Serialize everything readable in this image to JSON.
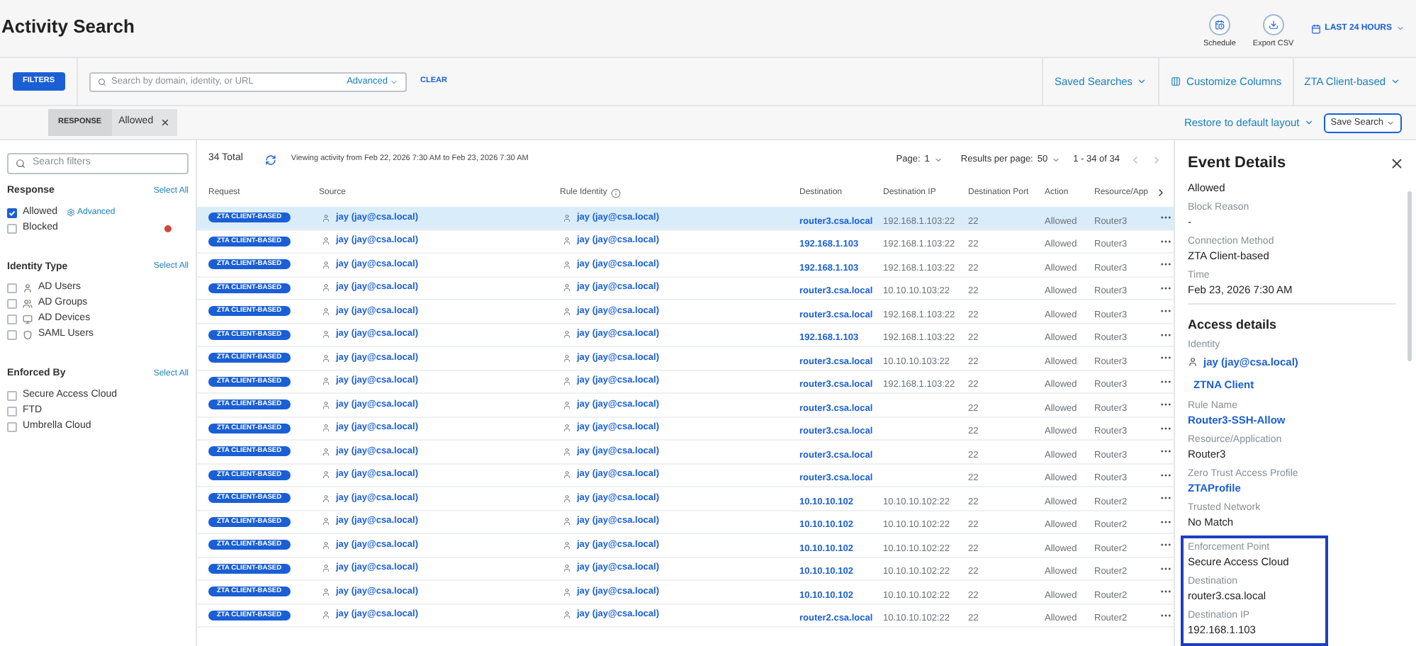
{
  "title": "Activity Search",
  "actions": [
    {
      "label": "Schedule",
      "kind": "schedule"
    },
    {
      "label": "Export CSV",
      "kind": "export"
    }
  ],
  "time_range": "LAST 24 HOURS",
  "toolbar": {
    "filters_button": "FILTERS",
    "search": {
      "placeholder": "Search by domain, identity, or URL",
      "advanced": "Advanced"
    },
    "clear": "CLEAR",
    "saved_searches": "Saved Searches",
    "customize_columns": "Customize Columns",
    "view": "ZTA Client-based"
  },
  "chips": [
    {
      "key": "RESPONSE",
      "value": "Allowed"
    }
  ],
  "layout_bar": {
    "restore": "Restore to default layout",
    "save_search": "Save Search"
  },
  "sidebar": {
    "search": {
      "placeholder": "Search filters"
    },
    "groups": [
      {
        "title": "Response",
        "select_all": "Select All",
        "items": [
          {
            "label": "Allowed",
            "checked": true,
            "kind": "plain",
            "link": "Advanced"
          },
          {
            "label": "Blocked",
            "checked": false,
            "kind": "plain",
            "color": "#d0453a"
          }
        ]
      },
      {
        "title": "Identity Type",
        "select_all": "Select All",
        "items": [
          {
            "label": "AD Users",
            "checked": false,
            "kind": "user"
          },
          {
            "label": "AD Groups",
            "checked": false,
            "kind": "group"
          },
          {
            "label": "AD Devices",
            "checked": false,
            "kind": "device"
          },
          {
            "label": "SAML Users",
            "checked": false,
            "kind": "saml"
          }
        ]
      },
      {
        "title": "Enforced By",
        "select_all": "Select All",
        "items": [
          {
            "label": "Secure Access Cloud",
            "checked": false,
            "kind": "plain"
          },
          {
            "label": "FTD",
            "checked": false,
            "kind": "plain"
          },
          {
            "label": "Umbrella Cloud",
            "checked": false,
            "kind": "plain"
          }
        ]
      }
    ]
  },
  "table": {
    "total": "34 Total",
    "viewing": "Viewing activity from Feb 22, 2026 7:30 AM to Feb 23, 2026 7:30 AM",
    "page_label": "Page:",
    "page": "1",
    "per_page_label": "Results per page:",
    "per_page": "50",
    "range": "1 - 34 of 34",
    "columns": [
      {
        "label": "Request",
        "has_info": false
      },
      {
        "label": "Source",
        "has_info": false
      },
      {
        "label": "Rule Identity",
        "has_info": true
      },
      {
        "label": "Destination",
        "has_info": false
      },
      {
        "label": "Destination IP",
        "has_info": false
      },
      {
        "label": "Destination Port",
        "has_info": false
      },
      {
        "label": "Action",
        "has_info": false
      },
      {
        "label": "Resource/App",
        "has_info": false
      }
    ],
    "rows": [
      {
        "request": "ZTA CLIENT-BASED",
        "source": "jay (jay@csa.local)",
        "rule_identity": "jay (jay@csa.local)",
        "destination": "router3.csa.local",
        "destination_ip": "192.168.1.103:22",
        "port": "22",
        "action": "Allowed",
        "resource": "Router3",
        "selected": true
      },
      {
        "request": "ZTA CLIENT-BASED",
        "source": "jay (jay@csa.local)",
        "rule_identity": "jay (jay@csa.local)",
        "destination": "192.168.1.103",
        "destination_ip": "192.168.1.103:22",
        "port": "22",
        "action": "Allowed",
        "resource": "Router3",
        "selected": false
      },
      {
        "request": "ZTA CLIENT-BASED",
        "source": "jay (jay@csa.local)",
        "rule_identity": "jay (jay@csa.local)",
        "destination": "192.168.1.103",
        "destination_ip": "192.168.1.103:22",
        "port": "22",
        "action": "Allowed",
        "resource": "Router3",
        "selected": false
      },
      {
        "request": "ZTA CLIENT-BASED",
        "source": "jay (jay@csa.local)",
        "rule_identity": "jay (jay@csa.local)",
        "destination": "router3.csa.local",
        "destination_ip": "10.10.10.103:22",
        "port": "22",
        "action": "Allowed",
        "resource": "Router3",
        "selected": false
      },
      {
        "request": "ZTA CLIENT-BASED",
        "source": "jay (jay@csa.local)",
        "rule_identity": "jay (jay@csa.local)",
        "destination": "router3.csa.local",
        "destination_ip": "192.168.1.103:22",
        "port": "22",
        "action": "Allowed",
        "resource": "Router3",
        "selected": false
      },
      {
        "request": "ZTA CLIENT-BASED",
        "source": "jay (jay@csa.local)",
        "rule_identity": "jay (jay@csa.local)",
        "destination": "192.168.1.103",
        "destination_ip": "192.168.1.103:22",
        "port": "22",
        "action": "Allowed",
        "resource": "Router3",
        "selected": false
      },
      {
        "request": "ZTA CLIENT-BASED",
        "source": "jay (jay@csa.local)",
        "rule_identity": "jay (jay@csa.local)",
        "destination": "router3.csa.local",
        "destination_ip": "10.10.10.103:22",
        "port": "22",
        "action": "Allowed",
        "resource": "Router3",
        "selected": false
      },
      {
        "request": "ZTA CLIENT-BASED",
        "source": "jay (jay@csa.local)",
        "rule_identity": "jay (jay@csa.local)",
        "destination": "router3.csa.local",
        "destination_ip": "192.168.1.103:22",
        "port": "22",
        "action": "Allowed",
        "resource": "Router3",
        "selected": false
      },
      {
        "request": "ZTA CLIENT-BASED",
        "source": "jay (jay@csa.local)",
        "rule_identity": "jay (jay@csa.local)",
        "destination": "router3.csa.local",
        "port": "22",
        "action": "Allowed",
        "resource": "Router3",
        "selected": false
      },
      {
        "request": "ZTA CLIENT-BASED",
        "source": "jay (jay@csa.local)",
        "rule_identity": "jay (jay@csa.local)",
        "destination": "router3.csa.local",
        "port": "22",
        "action": "Allowed",
        "resource": "Router3",
        "selected": false
      },
      {
        "request": "ZTA CLIENT-BASED",
        "source": "jay (jay@csa.local)",
        "rule_identity": "jay (jay@csa.local)",
        "destination": "router3.csa.local",
        "port": "22",
        "action": "Allowed",
        "resource": "Router3",
        "selected": false
      },
      {
        "request": "ZTA CLIENT-BASED",
        "source": "jay (jay@csa.local)",
        "rule_identity": "jay (jay@csa.local)",
        "destination": "router3.csa.local",
        "port": "22",
        "action": "Allowed",
        "resource": "Router3",
        "selected": false
      },
      {
        "request": "ZTA CLIENT-BASED",
        "source": "jay (jay@csa.local)",
        "rule_identity": "jay (jay@csa.local)",
        "destination": "10.10.10.102",
        "destination_ip": "10.10.10.102:22",
        "port": "22",
        "action": "Allowed",
        "resource": "Router2",
        "selected": false
      },
      {
        "request": "ZTA CLIENT-BASED",
        "source": "jay (jay@csa.local)",
        "rule_identity": "jay (jay@csa.local)",
        "destination": "10.10.10.102",
        "destination_ip": "10.10.10.102:22",
        "port": "22",
        "action": "Allowed",
        "resource": "Router2",
        "selected": false
      },
      {
        "request": "ZTA CLIENT-BASED",
        "source": "jay (jay@csa.local)",
        "rule_identity": "jay (jay@csa.local)",
        "destination": "10.10.10.102",
        "destination_ip": "10.10.10.102:22",
        "port": "22",
        "action": "Allowed",
        "resource": "Router2",
        "selected": false
      },
      {
        "request": "ZTA CLIENT-BASED",
        "source": "jay (jay@csa.local)",
        "rule_identity": "jay (jay@csa.local)",
        "destination": "10.10.10.102",
        "destination_ip": "10.10.10.102:22",
        "port": "22",
        "action": "Allowed",
        "resource": "Router2",
        "selected": false
      },
      {
        "request": "ZTA CLIENT-BASED",
        "source": "jay (jay@csa.local)",
        "rule_identity": "jay (jay@csa.local)",
        "destination": "10.10.10.102",
        "destination_ip": "10.10.10.102:22",
        "port": "22",
        "action": "Allowed",
        "resource": "Router2",
        "selected": false
      },
      {
        "request": "ZTA CLIENT-BASED",
        "source": "jay (jay@csa.local)",
        "rule_identity": "jay (jay@csa.local)",
        "destination": "router2.csa.local",
        "destination_ip": "10.10.10.102:22",
        "port": "22",
        "action": "Allowed",
        "resource": "Router2",
        "selected": false
      }
    ]
  },
  "details": {
    "title": "Event Details",
    "fields": [
      {
        "kind": "text",
        "value": "Allowed",
        "highlighted": false
      },
      {
        "kind": "text",
        "label": "Block Reason",
        "value": "-",
        "highlighted": false
      },
      {
        "kind": "text",
        "label": "Connection Method",
        "value": "ZTA Client-based",
        "highlighted": false
      },
      {
        "kind": "text",
        "label": "Time",
        "value": "Feb 23, 2026 7:30 AM",
        "highlighted": false
      },
      {
        "kind": "heading",
        "value": "Access details",
        "highlighted": false
      },
      {
        "kind": "identity",
        "label": "Identity",
        "value": "jay (jay@csa.local)",
        "extra": "ZTNA Client",
        "highlighted": false
      },
      {
        "kind": "link",
        "label": "Rule Name",
        "value": "Router3-SSH-Allow",
        "highlighted": false
      },
      {
        "kind": "text",
        "label": "Resource/Application",
        "value": "Router3",
        "highlighted": false
      },
      {
        "kind": "link",
        "label": "Zero Trust Access Profile",
        "value": "ZTAProfile",
        "highlighted": false
      },
      {
        "kind": "text",
        "label": "Trusted Network",
        "value": "No Match",
        "highlighted": false
      },
      {
        "kind": "text",
        "label": "Enforcement Point",
        "value": "Secure Access Cloud",
        "highlighted": true
      },
      {
        "kind": "text",
        "label": "Destination",
        "value": "router3.csa.local",
        "highlighted": true
      },
      {
        "kind": "text",
        "label": "Destination IP",
        "value": "192.168.1.103",
        "highlighted": true
      }
    ]
  }
}
